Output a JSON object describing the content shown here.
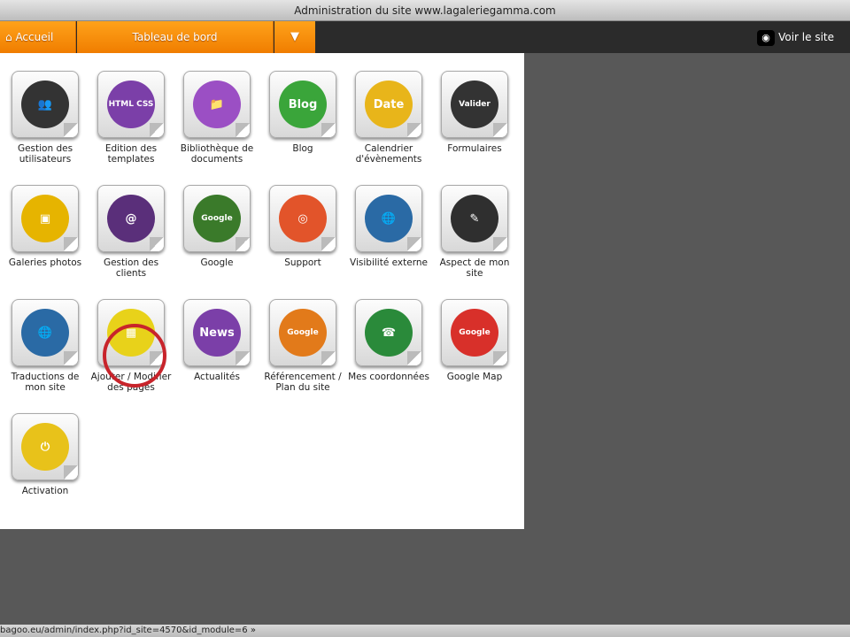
{
  "window_title": "Administration du site www.lagaleriegamma.com",
  "nav": {
    "home": "Accueil",
    "dashboard": "Tableau de bord",
    "dropdown": "▼",
    "view_site": "Voir le site"
  },
  "tiles": [
    {
      "label": "Gestion des utilisateurs",
      "glyph": "👥",
      "color": "#333333"
    },
    {
      "label": "Edition des templates",
      "glyph": "HTML CSS",
      "color": "#7b3fa8"
    },
    {
      "label": "Bibliothèque de documents",
      "glyph": "📁",
      "color": "#9b4fc4"
    },
    {
      "label": "Blog",
      "glyph": "Blog",
      "color": "#3aa53a"
    },
    {
      "label": "Calendrier d'évènements",
      "glyph": "Date",
      "color": "#e8b51a"
    },
    {
      "label": "Formulaires",
      "glyph": "Valider",
      "color": "#333333"
    },
    {
      "label": "Galeries photos",
      "glyph": "▣",
      "color": "#e6b400"
    },
    {
      "label": "Gestion des clients",
      "glyph": "@",
      "color": "#5a2f7a"
    },
    {
      "label": "Google",
      "glyph": "Google",
      "color": "#3a7a2a"
    },
    {
      "label": "Support",
      "glyph": "◎",
      "color": "#e2542a"
    },
    {
      "label": "Visibilité externe",
      "glyph": "🌐",
      "color": "#2a6aa5"
    },
    {
      "label": "Aspect de mon site",
      "glyph": "✎",
      "color": "#2f2f2f"
    },
    {
      "label": "Traductions de mon site",
      "glyph": "🌐",
      "color": "#2a6aa5"
    },
    {
      "label": "Ajouter / Modifier des pages",
      "glyph": "▦",
      "color": "#e8d21a"
    },
    {
      "label": "Actualités",
      "glyph": "News",
      "color": "#7b3fa8"
    },
    {
      "label": "Référencement / Plan du site",
      "glyph": "Google",
      "color": "#e27a1a"
    },
    {
      "label": "Mes coordonnées",
      "glyph": "☎",
      "color": "#2a8a3a"
    },
    {
      "label": "Google Map",
      "glyph": "Google",
      "color": "#d8302a"
    },
    {
      "label": "Activation",
      "glyph": "⏻",
      "color": "#e8c21a"
    }
  ],
  "status_url": "bagoo.eu/admin/index.php?id_site=4570&id_module=6 »"
}
